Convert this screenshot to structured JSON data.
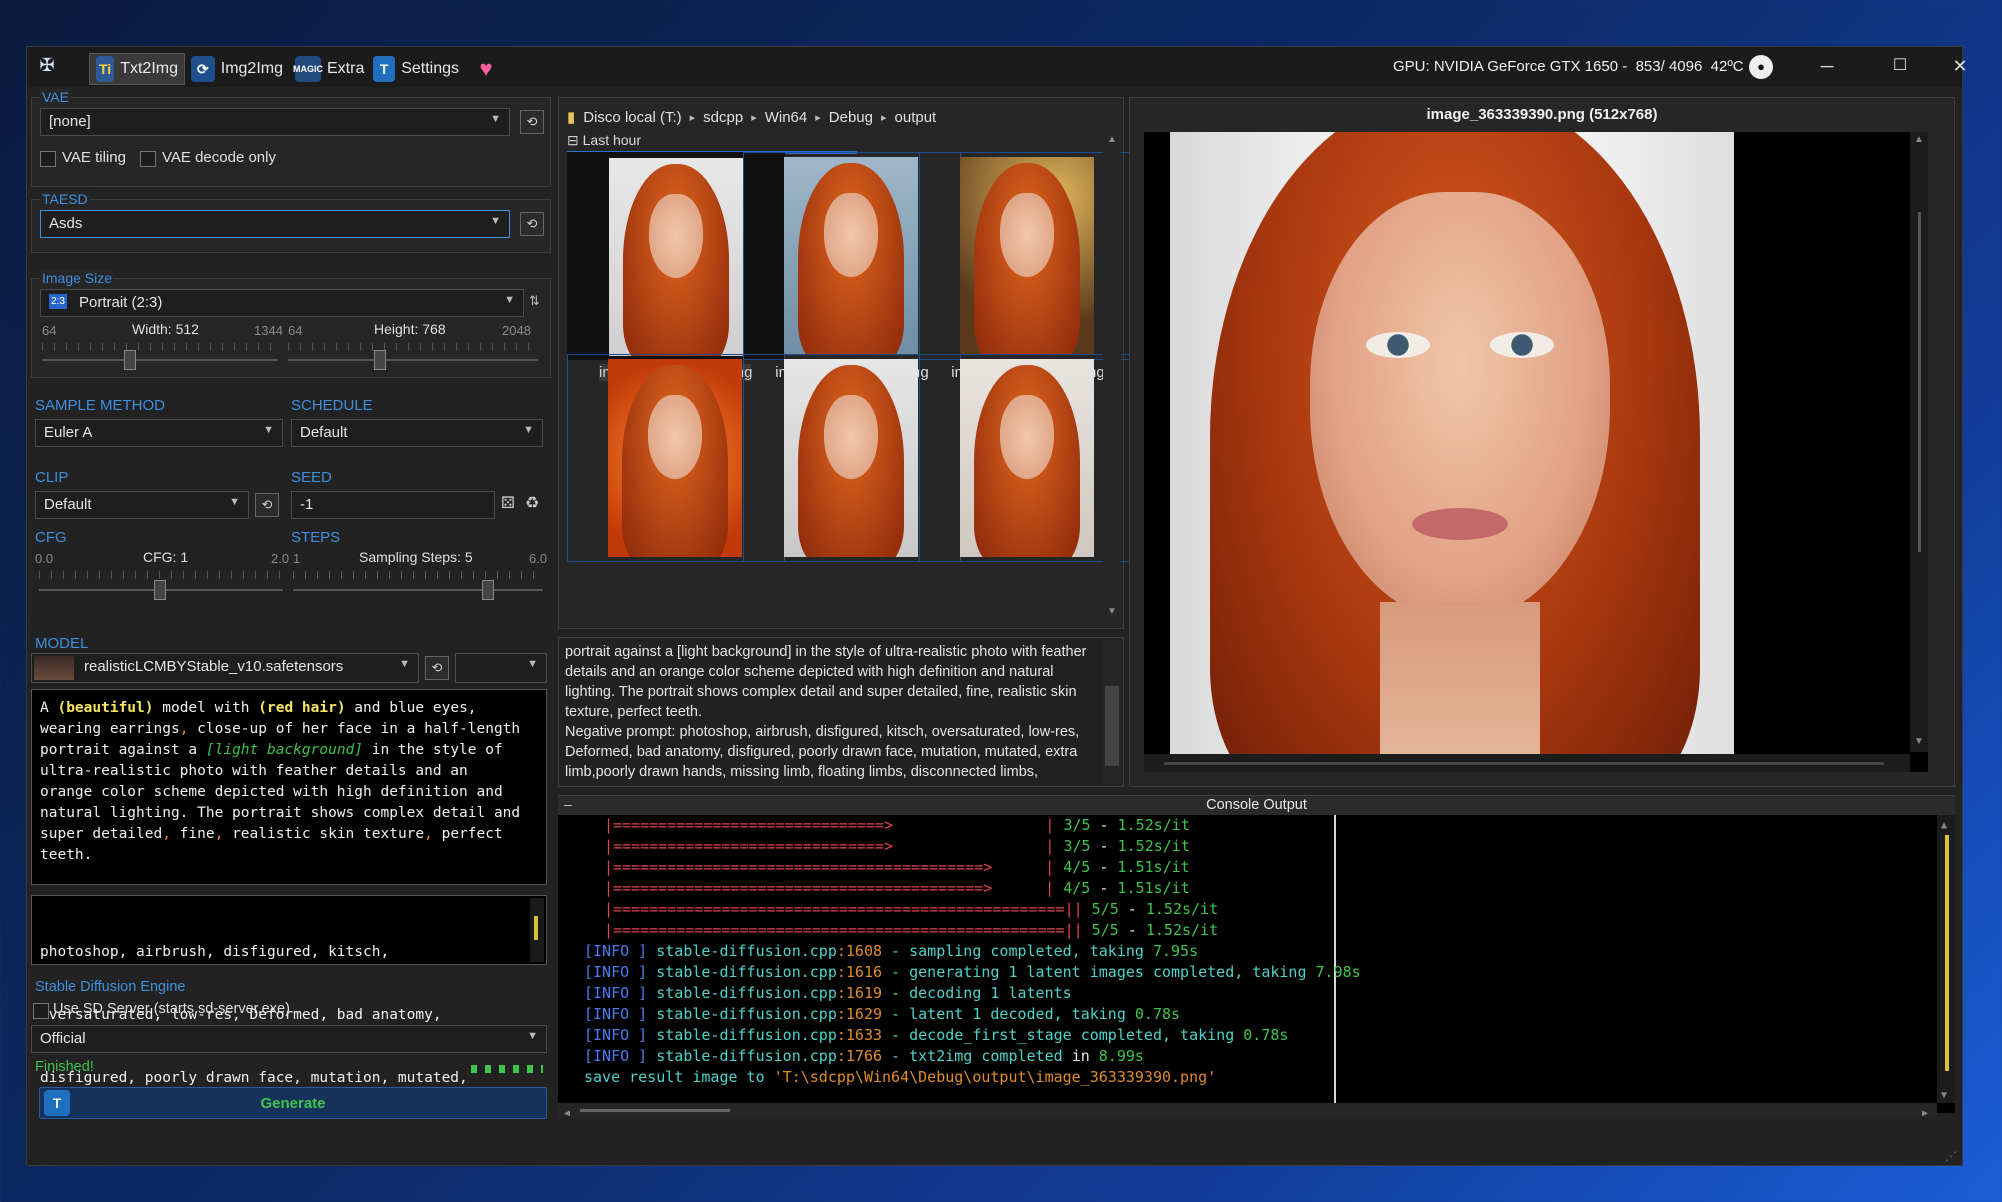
{
  "window": {
    "tabs": [
      {
        "label": "Txt2Img",
        "icon": "text-to-image-icon",
        "active": true
      },
      {
        "label": "Img2Img",
        "icon": "image-to-image-icon",
        "active": false
      },
      {
        "label": "Extra",
        "icon": "magic-extra-icon",
        "active": false
      },
      {
        "label": "Settings",
        "icon": "settings-icon",
        "active": false
      }
    ],
    "gpu_status": "GPU: NVIDIA GeForce GTX 1650 -  853/ 4096  42ºC"
  },
  "vae": {
    "legend": "VAE",
    "value": "[none]",
    "tiling_label": "VAE tiling",
    "decode_only_label": "VAE decode only"
  },
  "taesd": {
    "legend": "TAESD",
    "value": "Asds"
  },
  "image_size": {
    "legend": "Image Size",
    "preset_badge": "2:3",
    "preset": "Portrait (2:3)",
    "width_min": "64",
    "width_label": "Width: 512",
    "width_max": "1344",
    "width": 512,
    "height_min": "64",
    "height_label": "Height: 768",
    "height_max": "2048",
    "height": 768
  },
  "sampler": {
    "label": "SAMPLE METHOD",
    "value": "Euler A"
  },
  "schedule": {
    "label": "SCHEDULE",
    "value": "Default"
  },
  "clip": {
    "label": "CLIP",
    "value": "Default"
  },
  "seed": {
    "label": "SEED",
    "value": "-1"
  },
  "cfg": {
    "label": "CFG",
    "min": "0.0",
    "value_label": "CFG: 1",
    "max": "2.0",
    "value": 1.0
  },
  "steps": {
    "label": "STEPS",
    "min": "1",
    "value_label": "Sampling Steps: 5",
    "max": "6.0",
    "value": 5
  },
  "model": {
    "label": "MODEL",
    "value": "realisticLCMBYStable_v10.safetensors"
  },
  "prompt": {
    "parts": [
      "A ",
      "(beautiful)",
      " model with ",
      "(red hair)",
      " and blue eyes",
      ",\nwearing earrings",
      ",",
      " close-up of her face in a half-length\nportrait against a ",
      "[light background]",
      " in the style of\nultra-realistic photo with feather details and an\norange color scheme depicted with high definition and\nnatural lighting. The portrait shows complex detail and\nsuper detailed",
      ",",
      " fine",
      ",",
      " realistic skin texture",
      ",",
      " perfect\nteeth."
    ]
  },
  "negative_prompt": {
    "line1": "photoshop, airbrush, disfigured, kitsch,",
    "line2": "oversaturated, low-res, Deformed, bad anatomy,",
    "line3": "disfigured, poorly drawn face, mutation, mutated,"
  },
  "engine": {
    "label": "Stable Diffusion Engine",
    "server_label": "Use SD Server (starts sd-server.exe)",
    "value": "Official"
  },
  "status": {
    "text": "Finished!"
  },
  "generate_label": "Generate",
  "breadcrumb": [
    "Disco local (T:)",
    "sdcpp",
    "Win64",
    "Debug",
    "output"
  ],
  "gallery": {
    "group": "Last hour",
    "items": [
      {
        "name": "image_363339390.png"
      },
      {
        "name": "image_363279062.png"
      },
      {
        "name": "image_363252718.png"
      },
      {
        "name": ""
      },
      {
        "name": ""
      },
      {
        "name": ""
      }
    ]
  },
  "info_text": "portrait against a [light background] in the style of ultra-realistic photo with feather details and an orange color scheme depicted with high definition and natural lighting. The portrait shows complex detail and super detailed, fine, realistic skin texture, perfect teeth.\nNegative prompt: photoshop, airbrush, disfigured, kitsch, oversaturated, low-res, Deformed, bad anatomy, disfigured, poorly drawn face, mutation, mutated, extra limb,poorly drawn hands, missing limb, floating limbs, disconnected limbs, malformed hands, long neck, long body, disgusting, poorly drawn, mutilated, mangled, conjoined twins, extra legs, extra arms, meme, deformed, elongated, strabismus, heterochromia, watermark, extra fingers, hand bags, handbag, handbags, mustache, beard",
  "preview": {
    "title": "image_363339390.png (512x768)"
  },
  "console": {
    "title": "Console Output",
    "progress": [
      {
        "bar": "|==============================>",
        "step": "3/5",
        "rate": "1.52s/it"
      },
      {
        "bar": "|==============================>",
        "step": "3/5",
        "rate": "1.52s/it"
      },
      {
        "bar": "|=========================================>",
        "step": "4/5",
        "rate": "1.51s/it"
      },
      {
        "bar": "|=========================================>",
        "step": "4/5",
        "rate": "1.51s/it"
      },
      {
        "bar": "|==================================================|",
        "step": "5/5",
        "rate": "1.52s/it"
      },
      {
        "bar": "|==================================================|",
        "step": "5/5",
        "rate": "1.52s/it"
      }
    ],
    "logs": [
      {
        "tag": "[INFO ]",
        "file": "stable-diffusion.cpp",
        "line": ":1608",
        "msg": " - sampling completed, taking ",
        "val": "7.95s"
      },
      {
        "tag": "[INFO ]",
        "file": "stable-diffusion.cpp",
        "line": ":1616",
        "msg": " - generating 1 latent images completed, taking ",
        "val": "7.98s"
      },
      {
        "tag": "[INFO ]",
        "file": "stable-diffusion.cpp",
        "line": ":1619",
        "msg": " - decoding 1 latents",
        "val": ""
      },
      {
        "tag": "[INFO ]",
        "file": "stable-diffusion.cpp",
        "line": ":1629",
        "msg": " - latent 1 decoded, taking ",
        "val": "0.78s"
      },
      {
        "tag": "[INFO ]",
        "file": "stable-diffusion.cpp",
        "line": ":1633",
        "msg": " - decode_first_stage completed, taking ",
        "val": "0.78s"
      }
    ],
    "last_info": {
      "tag": "[INFO ]",
      "file": "stable-diffusion.cpp",
      "line": ":1766",
      "msg": " - txt2img completed ",
      "kw": "in",
      "val": " 8.99s"
    },
    "save_line": {
      "cmd": "save result image to ",
      "path": "'T:\\sdcpp\\Win64\\Debug\\output\\image_363339390.png'"
    }
  }
}
